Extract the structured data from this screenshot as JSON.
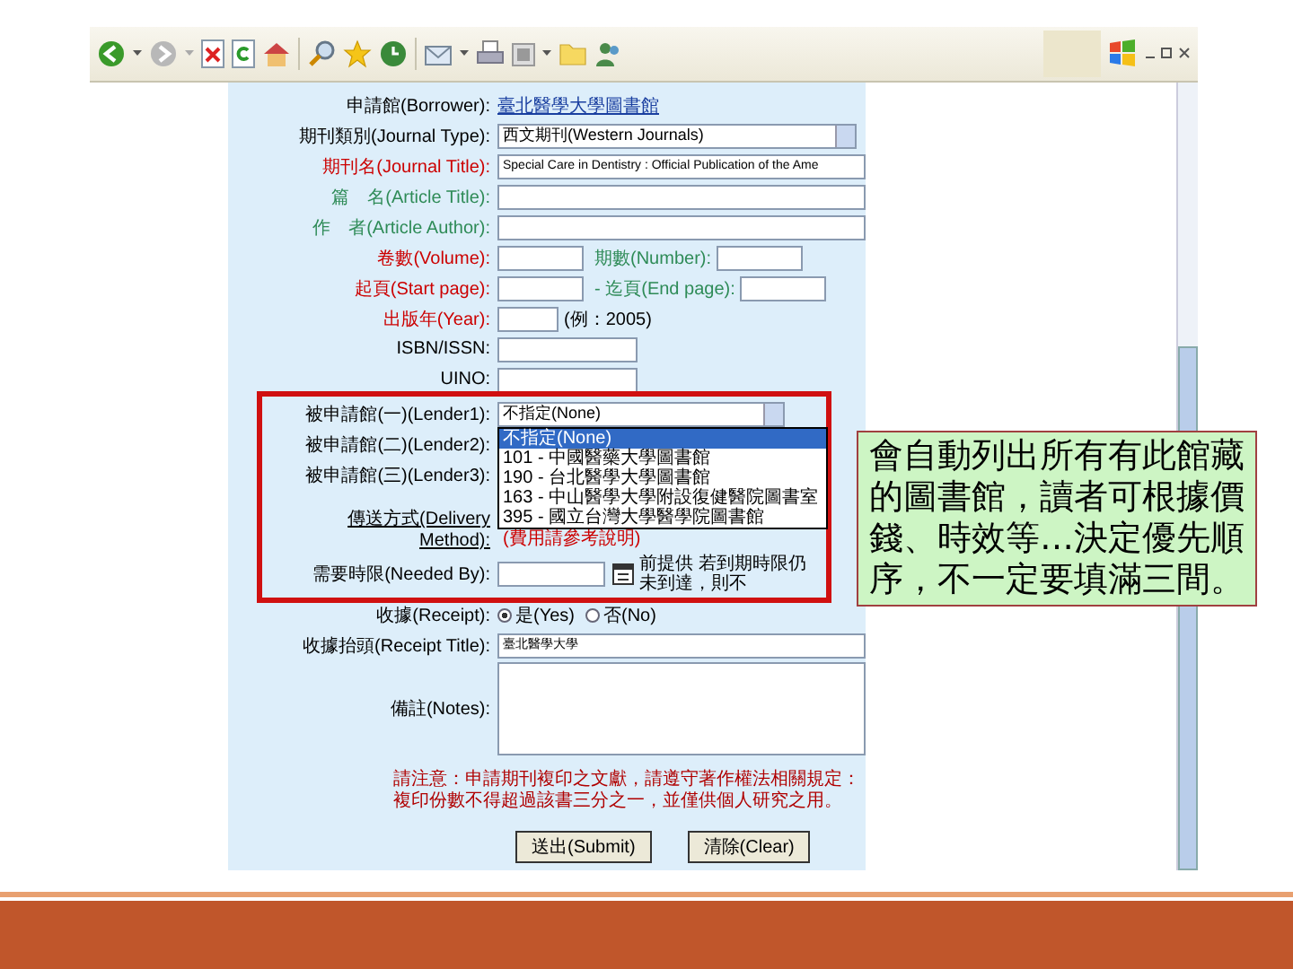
{
  "form": {
    "fields": [
      {
        "kind": "link",
        "label": "申請館(Borrower):",
        "color": "#000000",
        "value": "臺北醫學大學圖書館"
      },
      {
        "kind": "select",
        "label": "期刊類別(Journal Type):",
        "color": "#000000",
        "value": "西文期刊(Western Journals)"
      },
      {
        "kind": "text",
        "label": "期刊名(Journal Title):",
        "color": "#cc0000",
        "value": "Special Care in Dentistry : Official Publication of the Ame"
      },
      {
        "kind": "text",
        "label": "篇　名(Article Title):",
        "color": "#2e8b57"
      },
      {
        "kind": "text",
        "label": "作　者(Article Author):",
        "color": "#2e8b57"
      },
      {
        "kind": "pair",
        "label": "卷數(Volume):",
        "color": "#cc0000",
        "second_label": "期數(Number):"
      },
      {
        "kind": "pair",
        "label": "起頁(Start page):",
        "color": "#cc0000",
        "second_label": "- 迄頁(End page):"
      },
      {
        "kind": "hint",
        "label": "出版年(Year):",
        "color": "#cc0000",
        "hint": "(例：2005)"
      },
      {
        "kind": "short",
        "label": "ISBN/ISSN:",
        "color": "#000000"
      },
      {
        "kind": "short",
        "label": "UINO:",
        "color": "#000000"
      },
      {
        "kind": "lender",
        "label": "被申請館(一)(Lender1):",
        "color": "#000000",
        "value": "不指定(None)",
        "options": [
          {
            "label": "不指定(None)",
            "selected": true
          },
          {
            "label": "101 - 中國醫藥大學圖書館",
            "selected": false
          },
          {
            "label": "190 - 台北醫學大學圖書館",
            "selected": false
          },
          {
            "label": "163 - 中山醫學大學附設復健醫院圖書室",
            "selected": false
          },
          {
            "label": "395 - 國立台灣大學醫學院圖書館",
            "selected": false
          }
        ]
      },
      {
        "kind": "covered",
        "label": "被申請館(二)(Lender2):",
        "color": "#000000"
      },
      {
        "kind": "covered",
        "label": "被申請館(三)(Lender3):",
        "color": "#000000"
      },
      {
        "kind": "delivery",
        "label": "傳送方式(Delivery Method):",
        "color": "#000000",
        "hint": "(費用請參考說明)"
      },
      {
        "kind": "date",
        "label": "需要時限(Needed By):",
        "color": "#000000",
        "hint": "前提供 若到期時限仍未到達，則不"
      },
      {
        "kind": "radio",
        "label": "收據(Receipt):",
        "color": "#000000",
        "options": [
          {
            "label": "是(Yes)",
            "selected": true
          },
          {
            "label": "否(No)",
            "selected": false
          }
        ]
      },
      {
        "kind": "text",
        "label": "收據抬頭(Receipt Title):",
        "color": "#000000",
        "value": "臺北醫學大學"
      },
      {
        "kind": "textarea",
        "label": "備註(Notes):",
        "color": "#000000"
      }
    ],
    "notice": "請注意：申請期刊複印之文獻，請遵守著作權法相關規定：複印份數不得超過該書三分之一，並僅供個人研究之用。",
    "buttons": [
      "送出(Submit)",
      "清除(Clear)"
    ]
  },
  "callout": {
    "text": "會自動列出所有有此館藏的圖書館，讀者可根據價錢、時效等…決定優先順序，不一定要填滿三間。"
  }
}
